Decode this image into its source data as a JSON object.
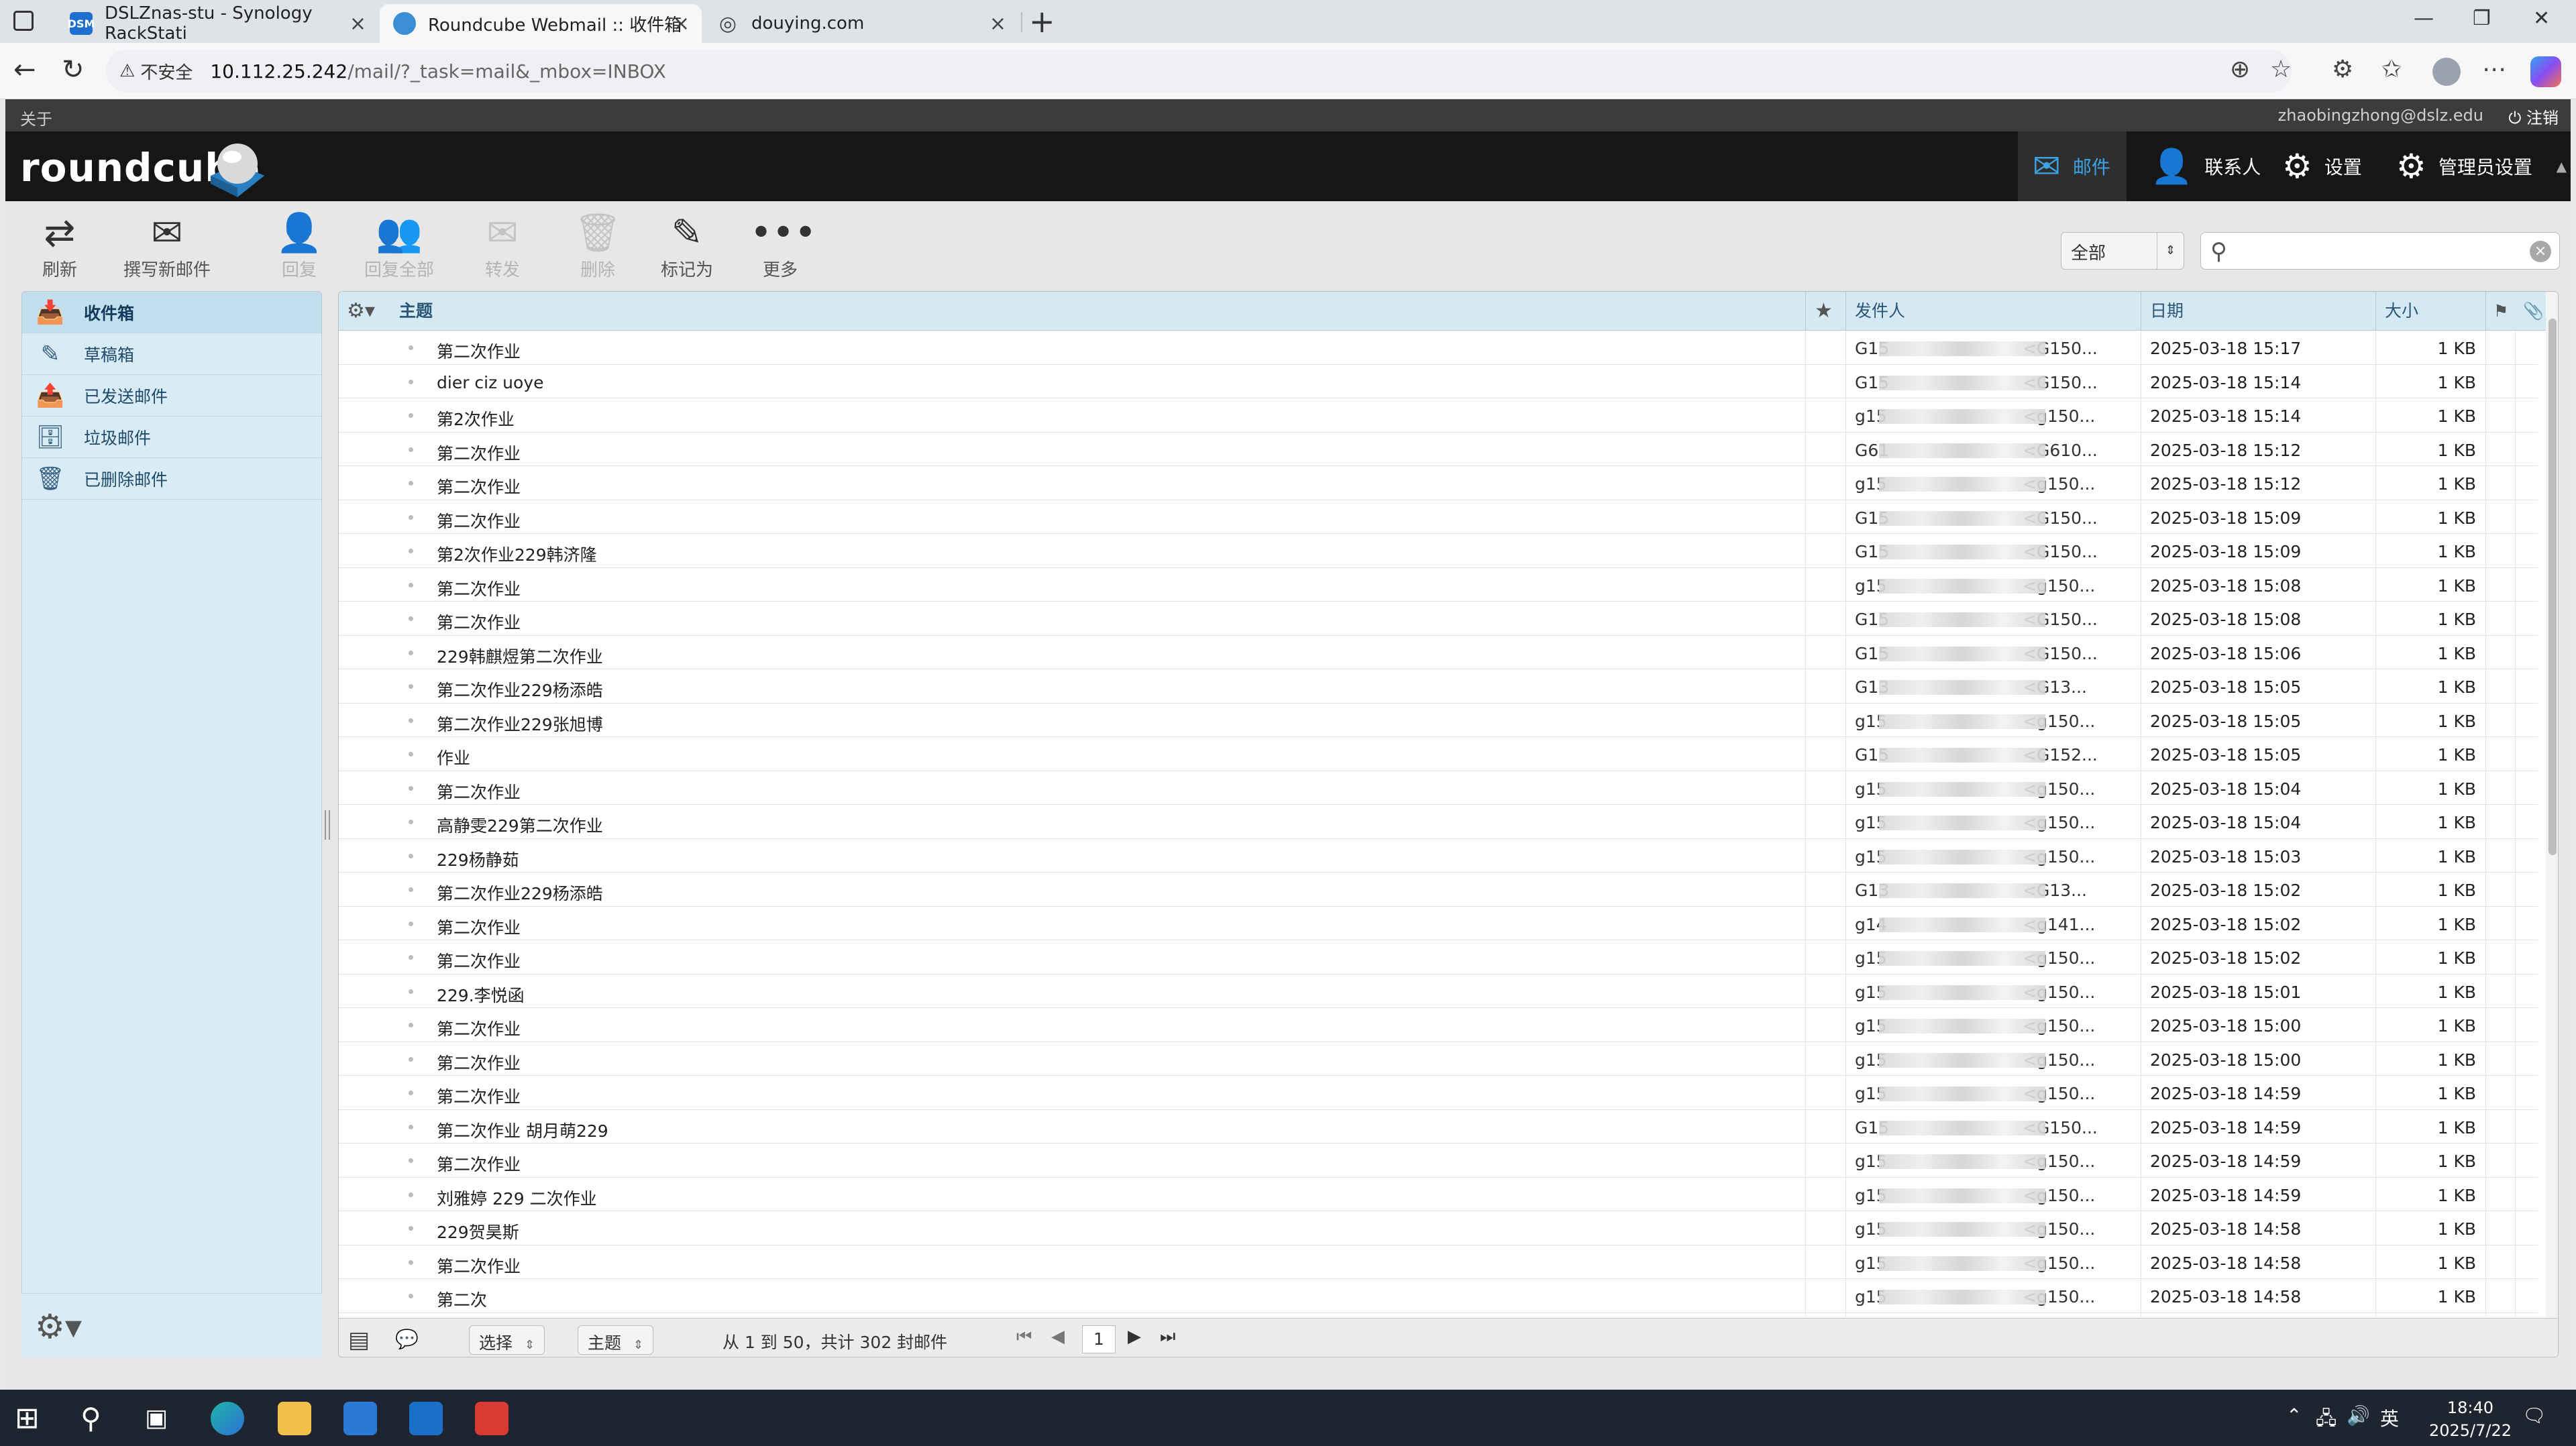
{
  "browser": {
    "tabs": [
      {
        "title": "DSLZnas-stu - Synology RackStati",
        "icon": "DSM"
      },
      {
        "title": "Roundcube Webmail :: 收件箱"
      },
      {
        "title": "douying.com"
      }
    ],
    "url": {
      "security_label": "不安全",
      "host": "10.112.25.242",
      "path": "/mail/?_task=mail&_mbox=INBOX"
    }
  },
  "topline": {
    "about": "关于",
    "user": "zhaobingzhong@dslz.edu",
    "logout": "注销"
  },
  "logo": "roundcube",
  "nav": [
    {
      "label": "邮件",
      "icon": "mail-icon"
    },
    {
      "label": "联系人",
      "icon": "person-icon"
    },
    {
      "label": "设置",
      "icon": "gear-icon"
    },
    {
      "label": "管理员设置",
      "icon": "gear-icon"
    }
  ],
  "toolbar": {
    "refresh": "刷新",
    "compose": "撰写新邮件",
    "reply": "回复",
    "reply_all": "回复全部",
    "forward": "转发",
    "delete": "删除",
    "mark": "标记为",
    "more": "更多",
    "filter": "全部"
  },
  "folders": [
    {
      "label": "收件箱",
      "icon": "inbox-icon"
    },
    {
      "label": "草稿箱",
      "icon": "pencil-icon"
    },
    {
      "label": "已发送邮件",
      "icon": "sent-icon"
    },
    {
      "label": "垃圾邮件",
      "icon": "junk-icon"
    },
    {
      "label": "已删除邮件",
      "icon": "trash-icon"
    }
  ],
  "list": {
    "headers": {
      "subject": "主题",
      "from": "发件人",
      "date": "日期",
      "size": "大小"
    },
    "rows": [
      {
        "subject": "第二次作业",
        "from_start": "G15",
        "from_end": "<G150...",
        "date": "2025-03-18 15:17",
        "size": "1 KB"
      },
      {
        "subject": "dier ciz uoye",
        "from_start": "G15",
        "from_end": "<G150...",
        "date": "2025-03-18 15:14",
        "size": "1 KB"
      },
      {
        "subject": "第2次作业",
        "from_start": "g15",
        "from_end": "<g150...",
        "date": "2025-03-18 15:14",
        "size": "1 KB"
      },
      {
        "subject": "第二次作业",
        "from_start": "G61",
        "from_end": "<G610...",
        "date": "2025-03-18 15:12",
        "size": "1 KB"
      },
      {
        "subject": "第二次作业",
        "from_start": "g15",
        "from_end": "<g150...",
        "date": "2025-03-18 15:12",
        "size": "1 KB"
      },
      {
        "subject": "第二次作业",
        "from_start": "G15",
        "from_end": "<G150...",
        "date": "2025-03-18 15:09",
        "size": "1 KB"
      },
      {
        "subject": "第2次作业229韩济隆",
        "from_start": "G15",
        "from_end": "<G150...",
        "date": "2025-03-18 15:09",
        "size": "1 KB"
      },
      {
        "subject": "第二次作业",
        "from_start": "g15",
        "from_end": "<g150...",
        "date": "2025-03-18 15:08",
        "size": "1 KB"
      },
      {
        "subject": "第二次作业",
        "from_start": "G15",
        "from_end": "<G150...",
        "date": "2025-03-18 15:08",
        "size": "1 KB"
      },
      {
        "subject": "229韩麒煜第二次作业",
        "from_start": "G15",
        "from_end": "<G150...",
        "date": "2025-03-18 15:06",
        "size": "1 KB"
      },
      {
        "subject": "第二次作业229杨添皓",
        "from_start": "G13",
        "from_end": "<G13...",
        "date": "2025-03-18 15:05",
        "size": "1 KB"
      },
      {
        "subject": "第二次作业229张旭博",
        "from_start": "g15",
        "from_end": "<g150...",
        "date": "2025-03-18 15:05",
        "size": "1 KB"
      },
      {
        "subject": "作业",
        "from_start": "G15",
        "from_end": "<G152...",
        "date": "2025-03-18 15:05",
        "size": "1 KB"
      },
      {
        "subject": "第二次作业",
        "from_start": "g15",
        "from_end": "<g150...",
        "date": "2025-03-18 15:04",
        "size": "1 KB"
      },
      {
        "subject": "高静雯229第二次作业",
        "from_start": "g15",
        "from_end": "<g150...",
        "date": "2025-03-18 15:04",
        "size": "1 KB"
      },
      {
        "subject": "229杨静茹",
        "from_start": "g15",
        "from_end": "<g150...",
        "date": "2025-03-18 15:03",
        "size": "1 KB"
      },
      {
        "subject": "第二次作业229杨添皓",
        "from_start": "G13",
        "from_end": "<G13...",
        "date": "2025-03-18 15:02",
        "size": "1 KB"
      },
      {
        "subject": "第二次作业",
        "from_start": "g14",
        "from_end": "<g141...",
        "date": "2025-03-18 15:02",
        "size": "1 KB"
      },
      {
        "subject": "第二次作业",
        "from_start": "g15",
        "from_end": "<g150...",
        "date": "2025-03-18 15:02",
        "size": "1 KB"
      },
      {
        "subject": "229.李悦函",
        "from_start": "g15",
        "from_end": "<g150...",
        "date": "2025-03-18 15:01",
        "size": "1 KB"
      },
      {
        "subject": "第二次作业",
        "from_start": "g15",
        "from_end": "<g150...",
        "date": "2025-03-18 15:00",
        "size": "1 KB"
      },
      {
        "subject": "第二次作业",
        "from_start": "g15",
        "from_end": "<g150...",
        "date": "2025-03-18 15:00",
        "size": "1 KB"
      },
      {
        "subject": "第二次作业",
        "from_start": "g15",
        "from_end": "<g150...",
        "date": "2025-03-18 14:59",
        "size": "1 KB"
      },
      {
        "subject": "第二次作业 胡月萌229",
        "from_start": "G15",
        "from_end": "<G150...",
        "date": "2025-03-18 14:59",
        "size": "1 KB"
      },
      {
        "subject": "第二次作业",
        "from_start": "g15",
        "from_end": "<g150...",
        "date": "2025-03-18 14:59",
        "size": "1 KB"
      },
      {
        "subject": "刘雅婷 229 二次作业",
        "from_start": "g15",
        "from_end": "<g150...",
        "date": "2025-03-18 14:59",
        "size": "1 KB"
      },
      {
        "subject": "229贺昊斯",
        "from_start": "g15",
        "from_end": "<g150...",
        "date": "2025-03-18 14:58",
        "size": "1 KB"
      },
      {
        "subject": "第二次作业",
        "from_start": "g15",
        "from_end": "<g150...",
        "date": "2025-03-18 14:58",
        "size": "1 KB"
      },
      {
        "subject": "第二次",
        "from_start": "g15",
        "from_end": "<g150...",
        "date": "2025-03-18 14:58",
        "size": "1 KB"
      }
    ]
  },
  "footer": {
    "select": "选择",
    "threads": "主题",
    "count_text": "从 1 到 50，共计 302 封邮件",
    "page": "1"
  },
  "taskbar": {
    "time": "18:40",
    "date": "2025/7/22",
    "ime": "英"
  }
}
